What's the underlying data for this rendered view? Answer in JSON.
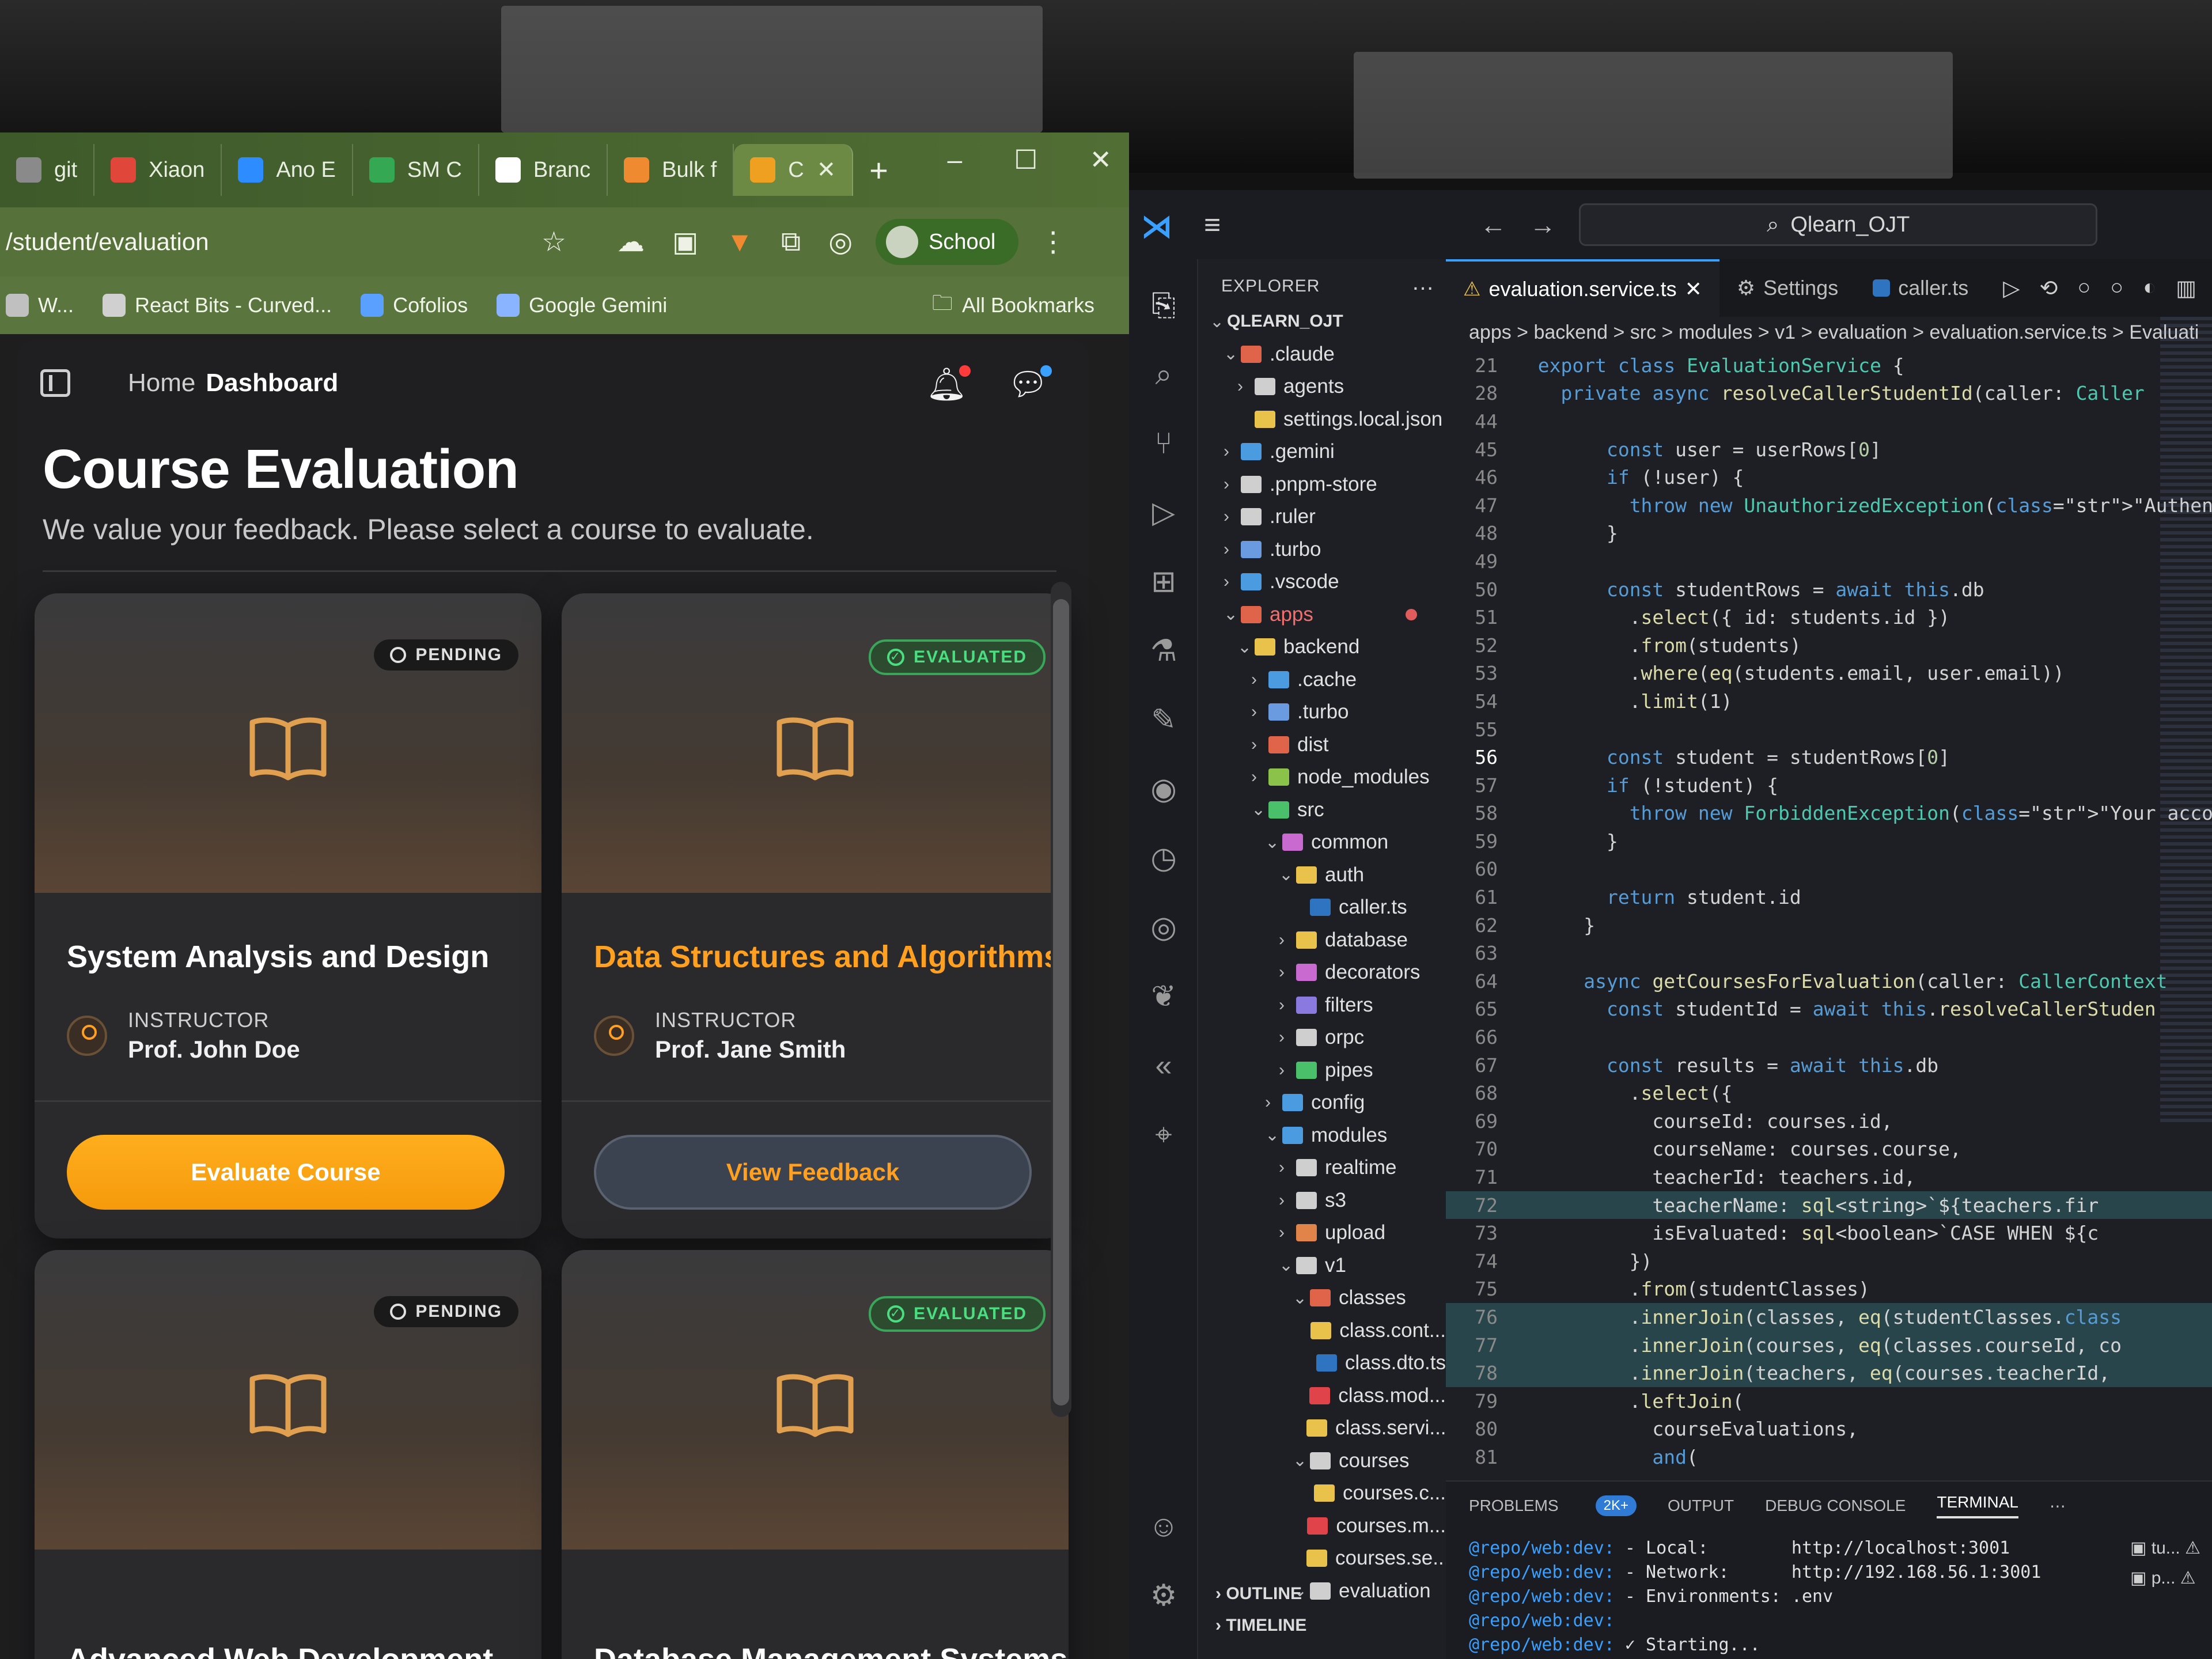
{
  "browser": {
    "tabs": [
      {
        "label": "git",
        "color": "#8a8a8a"
      },
      {
        "label": "Xiaon",
        "color": "#e0473a"
      },
      {
        "label": "Ano E",
        "color": "#2d8cff"
      },
      {
        "label": "SM C",
        "color": "#34a853"
      },
      {
        "label": "Branc",
        "color": "#ffffff"
      },
      {
        "label": "Bulk f",
        "color": "#f08a30"
      },
      {
        "label": "C",
        "color": "#f0a020"
      }
    ],
    "new_tab": "+",
    "url": "/student/evaluation",
    "profile": "School",
    "bookmarks": [
      {
        "label": "W...",
        "color": "#c0c0c0"
      },
      {
        "label": "React Bits - Curved...",
        "color": "#d0d0d0"
      },
      {
        "label": "Cofolios",
        "color": "#5aa0ff"
      },
      {
        "label": "Google Gemini",
        "color": "#8ab4ff"
      }
    ],
    "all_bookmarks": "All Bookmarks"
  },
  "app": {
    "breadcrumb_home": "Home",
    "breadcrumb_current": "Dashboard",
    "title": "Course Evaluation",
    "subtitle": "We value your feedback. Please select a course to evaluate.",
    "instructor_label": "INSTRUCTOR",
    "courses": [
      {
        "title": "System Analysis and Design",
        "status": "PENDING",
        "instructor": "Prof. John Doe",
        "action": "Evaluate Course"
      },
      {
        "title": "Data Structures and Algorithms",
        "status": "EVALUATED",
        "instructor": "Prof. Jane Smith",
        "action": "View Feedback"
      },
      {
        "title": "Advanced Web Development",
        "status": "PENDING"
      },
      {
        "title": "Database Management Systems",
        "status": "EVALUATED"
      }
    ]
  },
  "vscode": {
    "search": "Qlearn_OJT",
    "explorer_title": "EXPLORER",
    "root": "QLEARN_OJT",
    "tree": [
      {
        "d": 1,
        "open": true,
        "name": ".claude",
        "c": "#e0644a"
      },
      {
        "d": 2,
        "open": false,
        "name": "agents",
        "c": "#cfcfcf"
      },
      {
        "d": 2,
        "file": true,
        "name": "settings.local.json",
        "c": "#e8c24a"
      },
      {
        "d": 1,
        "open": false,
        "name": ".gemini",
        "c": "#4a9be0"
      },
      {
        "d": 1,
        "open": false,
        "name": ".pnpm-store",
        "c": "#cfcfcf"
      },
      {
        "d": 1,
        "open": false,
        "name": ".ruler",
        "c": "#cfcfcf"
      },
      {
        "d": 1,
        "open": false,
        "name": ".turbo",
        "c": "#6a9be0"
      },
      {
        "d": 1,
        "open": false,
        "name": ".vscode",
        "c": "#4a9be0"
      },
      {
        "d": 1,
        "open": true,
        "name": "apps",
        "c": "#e0644a",
        "mod": true
      },
      {
        "d": 2,
        "open": true,
        "name": "backend",
        "c": "#e8c24a"
      },
      {
        "d": 3,
        "open": false,
        "name": ".cache",
        "c": "#4a9be0"
      },
      {
        "d": 3,
        "open": false,
        "name": ".turbo",
        "c": "#6a9be0"
      },
      {
        "d": 3,
        "open": false,
        "name": "dist",
        "c": "#e0644a"
      },
      {
        "d": 3,
        "open": false,
        "name": "node_modules",
        "c": "#8ac24a"
      },
      {
        "d": 3,
        "open": true,
        "name": "src",
        "c": "#4ac06a"
      },
      {
        "d": 4,
        "open": true,
        "name": "common",
        "c": "#c86ad0"
      },
      {
        "d": 5,
        "open": true,
        "name": "auth",
        "c": "#e8c24a"
      },
      {
        "d": 6,
        "file": true,
        "name": "caller.ts",
        "c": "#2f74c0"
      },
      {
        "d": 5,
        "open": false,
        "name": "database",
        "c": "#e8c24a"
      },
      {
        "d": 5,
        "open": false,
        "name": "decorators",
        "c": "#c86ad0"
      },
      {
        "d": 5,
        "open": false,
        "name": "filters",
        "c": "#8a7ae0"
      },
      {
        "d": 5,
        "open": false,
        "name": "orpc",
        "c": "#cfcfcf"
      },
      {
        "d": 5,
        "open": false,
        "name": "pipes",
        "c": "#4ac06a"
      },
      {
        "d": 4,
        "open": false,
        "name": "config",
        "c": "#4a9be0"
      },
      {
        "d": 4,
        "open": true,
        "name": "modules",
        "c": "#4a9be0"
      },
      {
        "d": 5,
        "open": false,
        "name": "realtime",
        "c": "#cfcfcf"
      },
      {
        "d": 5,
        "open": false,
        "name": "s3",
        "c": "#cfcfcf"
      },
      {
        "d": 5,
        "open": false,
        "name": "upload",
        "c": "#e0844a"
      },
      {
        "d": 5,
        "open": true,
        "name": "v1",
        "c": "#cfcfcf"
      },
      {
        "d": 6,
        "open": true,
        "name": "classes",
        "c": "#e0644a"
      },
      {
        "d": 7,
        "file": true,
        "name": "class.cont...",
        "c": "#e8c24a"
      },
      {
        "d": 7,
        "file": true,
        "name": "class.dto.ts",
        "c": "#2f74c0"
      },
      {
        "d": 7,
        "file": true,
        "name": "class.mod...",
        "c": "#e0444a"
      },
      {
        "d": 7,
        "file": true,
        "name": "class.servi...",
        "c": "#e8c24a"
      },
      {
        "d": 6,
        "open": true,
        "name": "courses",
        "c": "#cfcfcf"
      },
      {
        "d": 7,
        "file": true,
        "name": "courses.c...",
        "c": "#e8c24a"
      },
      {
        "d": 7,
        "file": true,
        "name": "courses.m...",
        "c": "#e0444a"
      },
      {
        "d": 7,
        "file": true,
        "name": "courses.se...",
        "c": "#e8c24a"
      },
      {
        "d": 6,
        "open": true,
        "name": "evaluation",
        "c": "#cfcfcf"
      }
    ],
    "outline": "OUTLINE",
    "timeline": "TIMELINE",
    "tabs": [
      {
        "label": "evaluation.service.ts",
        "active": true
      },
      {
        "label": "Settings",
        "active": false
      },
      {
        "label": "caller.ts",
        "active": false
      }
    ],
    "breadcrumbs": "apps > backend > src > modules > v1 > evaluation > evaluation.service.ts > Evaluati",
    "code": [
      {
        "n": "21",
        "t": "  export class EvaluationService {"
      },
      {
        "n": "28",
        "t": "    private async resolveCallerStudentId(caller: Caller"
      },
      {
        "n": "44",
        "t": ""
      },
      {
        "n": "45",
        "t": "        const user = userRows[0]"
      },
      {
        "n": "46",
        "t": "        if (!user) {"
      },
      {
        "n": "47",
        "t": "          throw new UnauthorizedException(\"Authentica"
      },
      {
        "n": "48",
        "t": "        }"
      },
      {
        "n": "49",
        "t": ""
      },
      {
        "n": "50",
        "t": "        const studentRows = await this.db"
      },
      {
        "n": "51",
        "t": "          .select({ id: students.id })"
      },
      {
        "n": "52",
        "t": "          .from(students)"
      },
      {
        "n": "53",
        "t": "          .where(eq(students.email, user.email))"
      },
      {
        "n": "54",
        "t": "          .limit(1)"
      },
      {
        "n": "55",
        "t": ""
      },
      {
        "n": "56",
        "t": "        const student = studentRows[0]",
        "cur": true
      },
      {
        "n": "57",
        "t": "        if (!student) {"
      },
      {
        "n": "58",
        "t": "          throw new ForbiddenException(\"Your account"
      },
      {
        "n": "59",
        "t": "        }"
      },
      {
        "n": "60",
        "t": ""
      },
      {
        "n": "61",
        "t": "        return student.id"
      },
      {
        "n": "62",
        "t": "      }"
      },
      {
        "n": "63",
        "t": ""
      },
      {
        "n": "64",
        "t": "      async getCoursesForEvaluation(caller: CallerContext"
      },
      {
        "n": "65",
        "t": "        const studentId = await this.resolveCallerStuden"
      },
      {
        "n": "66",
        "t": ""
      },
      {
        "n": "67",
        "t": "        const results = await this.db"
      },
      {
        "n": "68",
        "t": "          .select({"
      },
      {
        "n": "69",
        "t": "            courseId: courses.id,"
      },
      {
        "n": "70",
        "t": "            courseName: courses.course,"
      },
      {
        "n": "71",
        "t": "            teacherId: teachers.id,"
      },
      {
        "n": "72",
        "t": "            teacherName: sql<string>`${teachers.fir",
        "hl": true
      },
      {
        "n": "73",
        "t": "            isEvaluated: sql<boolean>`CASE WHEN ${c"
      },
      {
        "n": "74",
        "t": "          })"
      },
      {
        "n": "75",
        "t": "          .from(studentClasses)"
      },
      {
        "n": "76",
        "t": "          .innerJoin(classes, eq(studentClasses.class",
        "hl": true
      },
      {
        "n": "77",
        "t": "          .innerJoin(courses, eq(classes.courseId, co",
        "hl": true
      },
      {
        "n": "78",
        "t": "          .innerJoin(teachers, eq(courses.teacherId, ",
        "hl": true
      },
      {
        "n": "79",
        "t": "          .leftJoin("
      },
      {
        "n": "80",
        "t": "            courseEvaluations,"
      },
      {
        "n": "81",
        "t": "            and("
      }
    ],
    "panel_tabs": [
      "PROBLEMS",
      "OUTPUT",
      "DEBUG CONSOLE",
      "TERMINAL"
    ],
    "problems_count": "2K+",
    "terminal": [
      {
        "p": "@repo/web:dev:",
        "t": " - Local:        http://localhost:3001"
      },
      {
        "p": "@repo/web:dev:",
        "t": " - Network:      http://192.168.56.1:3001"
      },
      {
        "p": "@repo/web:dev:",
        "t": " - Environments: .env"
      },
      {
        "p": "@repo/web:dev:",
        "t": ""
      },
      {
        "p": "@repo/web:dev:",
        "t": " ✓ Starting..."
      }
    ],
    "terminals": [
      "tu...",
      "p..."
    ]
  }
}
